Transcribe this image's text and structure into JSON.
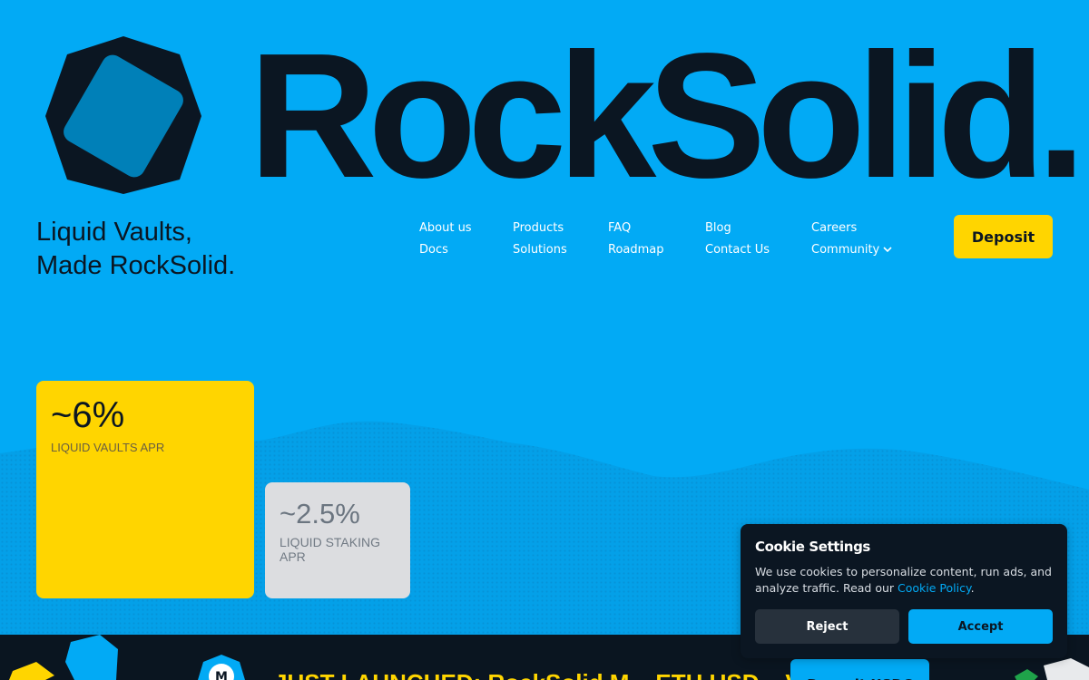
{
  "brand": {
    "wordmark": "RockSolid.",
    "tagline_line1": "Liquid Vaults,",
    "tagline_line2": "Made RockSolid."
  },
  "nav": {
    "columns": [
      [
        "About us",
        "Docs"
      ],
      [
        "Products",
        "Solutions"
      ],
      [
        "FAQ",
        "Roadmap"
      ],
      [
        "Blog",
        "Contact Us"
      ],
      [
        "Careers",
        "Community"
      ]
    ],
    "deposit_label": "Deposit"
  },
  "stats": [
    {
      "value": "~6%",
      "label": "LIQUID VAULTS APR"
    },
    {
      "value": "~2.5%",
      "label": "LIQUID STAKING APR"
    }
  ],
  "banner": {
    "text": "JUST LAUNCHED: RockSolid M... ETH USD... Vault",
    "button_label": "Deposit USDC"
  },
  "cookie": {
    "title": "Cookie Settings",
    "text": "We use cookies to personalize content, run ads, and analyze traffic. Read our ",
    "link": "Cookie Policy",
    "text_end": ".",
    "reject_label": "Reject",
    "accept_label": "Accept"
  },
  "colors": {
    "background": "#02aaf5",
    "accent_yellow": "#ffd500",
    "dark": "#0b1622",
    "stat_gray": "#dcdde0"
  },
  "icons": {
    "logo": "rock-hexagon-icon",
    "community_dropdown": "chevron-down-icon"
  }
}
